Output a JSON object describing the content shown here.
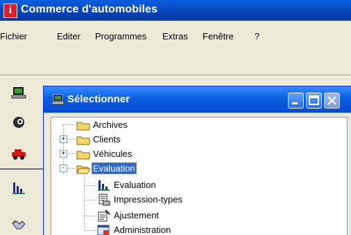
{
  "app": {
    "title": "Commerce d'automobiles",
    "icon": "info-i-icon",
    "icon_glyph": "i"
  },
  "menu": [
    "Fichier",
    "Editer",
    "Programmes",
    "Extras",
    "Fenêtre",
    "?"
  ],
  "sidebar": {
    "icons": [
      "computer-icon",
      "person-icon",
      "car-icon",
      "bar-chart-icon",
      "handshake-icon"
    ]
  },
  "dialog": {
    "title": "Sélectionner",
    "icon": "computer-icon",
    "buttons": [
      "minimize-icon",
      "maximize-icon",
      "close-icon"
    ]
  },
  "tree": {
    "items": [
      {
        "label": "Archives",
        "icon": "folder-icon",
        "expander": ""
      },
      {
        "label": "Clients",
        "icon": "folder-icon",
        "expander": "+"
      },
      {
        "label": "Véhicules",
        "icon": "folder-icon",
        "expander": "+"
      },
      {
        "label": "Evaluation",
        "icon": "folder-open-icon",
        "expander": "-",
        "selected": true
      },
      {
        "label": "Evaluation",
        "icon": "bar-chart-icon"
      },
      {
        "label": "Impression-types",
        "icon": "print-template-icon"
      },
      {
        "label": "Ajustement",
        "icon": "adjust-icon"
      },
      {
        "label": "Administration",
        "icon": "admin-icon"
      }
    ]
  },
  "colors": {
    "titlebar": "#0a5fe0",
    "selection": "#316ac5",
    "window_bg": "#ece9d8"
  }
}
